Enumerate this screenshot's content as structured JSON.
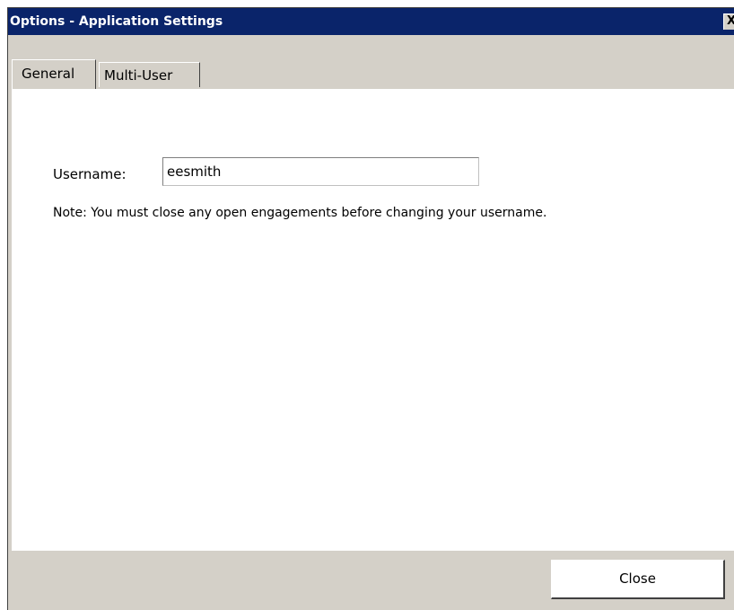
{
  "window": {
    "title": "Options - Application Settings",
    "close_glyph": "X",
    "titlebar_color": "#0a246a",
    "face_color": "#d4d0c8"
  },
  "tabs": [
    {
      "label": "General",
      "selected": true
    },
    {
      "label": "Multi-User",
      "selected": false
    }
  ],
  "general": {
    "username_label": "Username:",
    "username_value": "eesmith",
    "note": "Note:  You must close any open engagements before changing your username."
  },
  "footer": {
    "close_label": "Close"
  }
}
